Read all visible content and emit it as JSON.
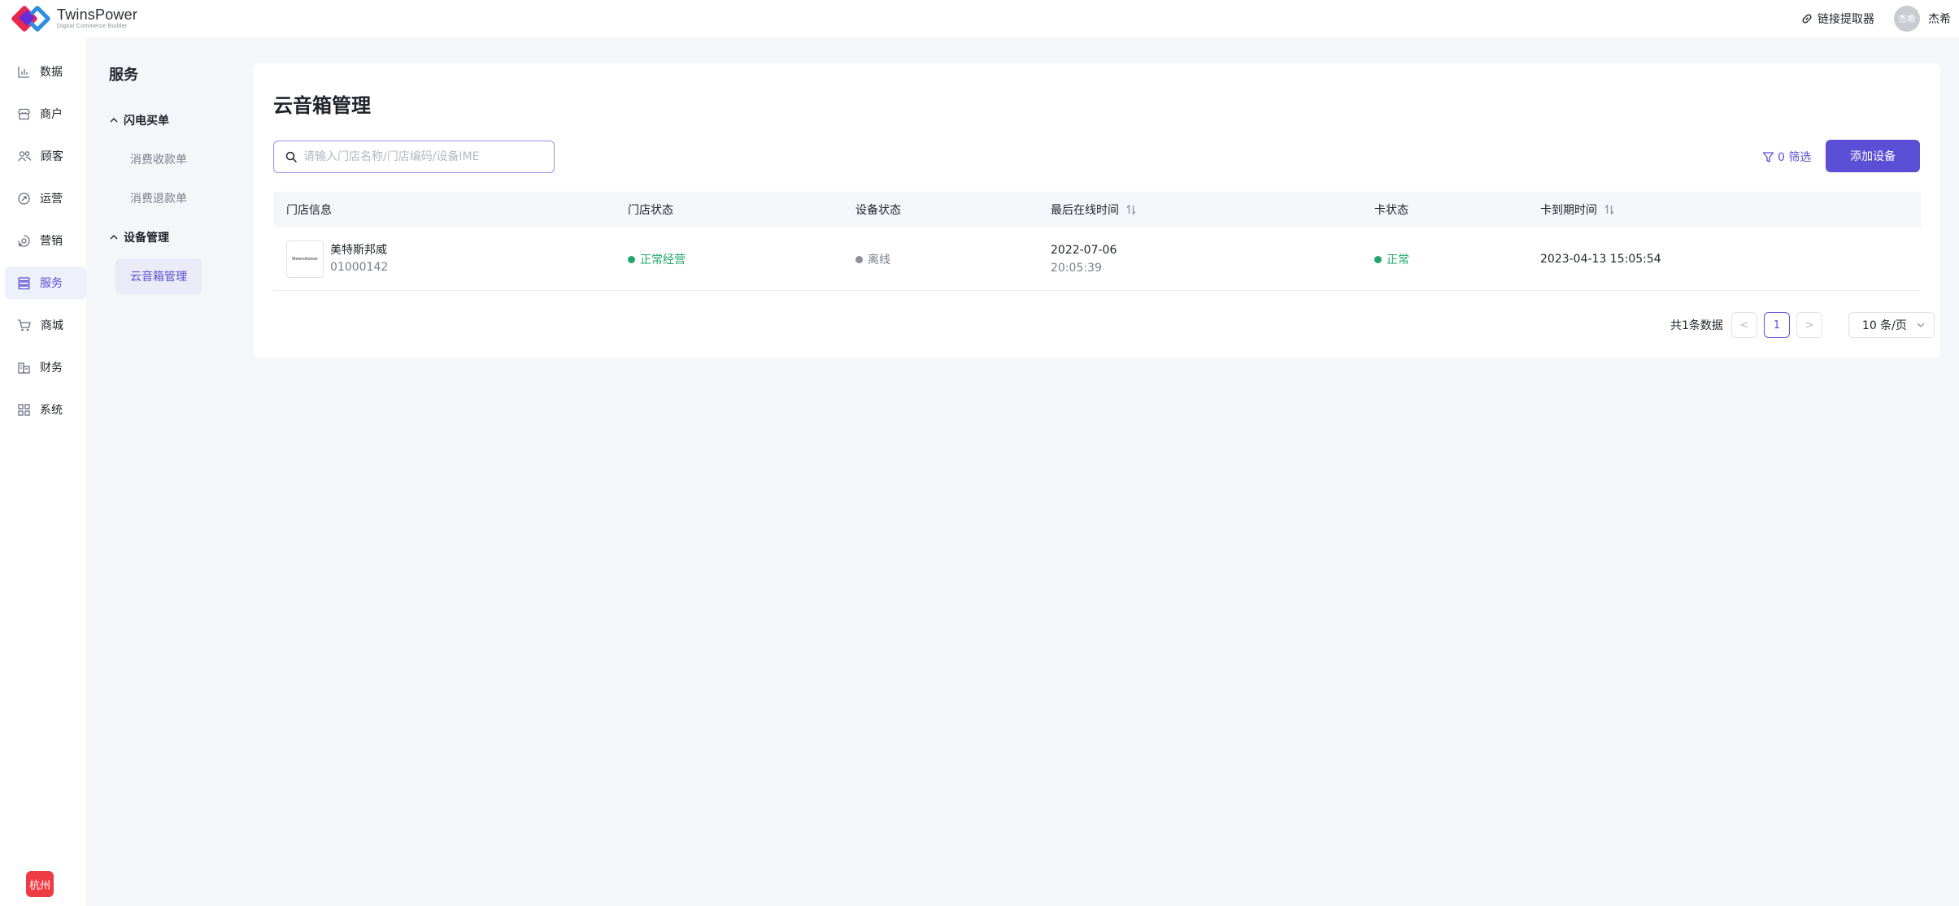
{
  "header": {
    "brand_name": "TwinsPower",
    "brand_tagline": "Digital Commerce Builder",
    "link_tool_label": "链接提取器",
    "avatar_text": "杰希",
    "user_name": "杰希"
  },
  "nav": {
    "items": [
      {
        "label": "数据",
        "icon": "chart-icon"
      },
      {
        "label": "商户",
        "icon": "store-icon"
      },
      {
        "label": "顾客",
        "icon": "users-icon"
      },
      {
        "label": "运营",
        "icon": "operation-icon"
      },
      {
        "label": "营销",
        "icon": "marketing-icon"
      },
      {
        "label": "服务",
        "icon": "service-icon",
        "active": true
      },
      {
        "label": "商城",
        "icon": "cart-icon"
      },
      {
        "label": "财务",
        "icon": "finance-icon"
      },
      {
        "label": "系统",
        "icon": "grid-icon"
      }
    ],
    "city_badge": "杭州"
  },
  "subnav": {
    "title": "服务",
    "groups": [
      {
        "label": "闪电买单",
        "items": [
          "消费收款单",
          "消费退款单"
        ]
      },
      {
        "label": "设备管理",
        "items": [
          "云音箱管理"
        ]
      }
    ],
    "active_item": "云音箱管理"
  },
  "main": {
    "title": "云音箱管理",
    "search_placeholder": "请输入门店名称/门店编码/设备IME",
    "filter_label": "0 筛选",
    "add_button_label": "添加设备",
    "table": {
      "columns": [
        "门店信息",
        "门店状态",
        "设备状态",
        "最后在线时间",
        "卡状态",
        "卡到期时间"
      ],
      "rows": [
        {
          "store_logo_text": "Meters/bonwe",
          "store_name": "美特斯邦威",
          "store_code": "01000142",
          "store_status": "正常经营",
          "device_status": "离线",
          "last_online_date": "2022-07-06",
          "last_online_time": "20:05:39",
          "card_status": "正常",
          "card_expiry": "2023-04-13 15:05:54"
        }
      ]
    },
    "pagination": {
      "total_text": "共1条数据",
      "prev": "<",
      "current_page": "1",
      "next": ">",
      "page_size": "10 条/页"
    }
  },
  "colors": {
    "accent": "#5b4fd6",
    "success": "#20a66a",
    "offline": "#8a8f99",
    "badge": "#ef3b43"
  }
}
